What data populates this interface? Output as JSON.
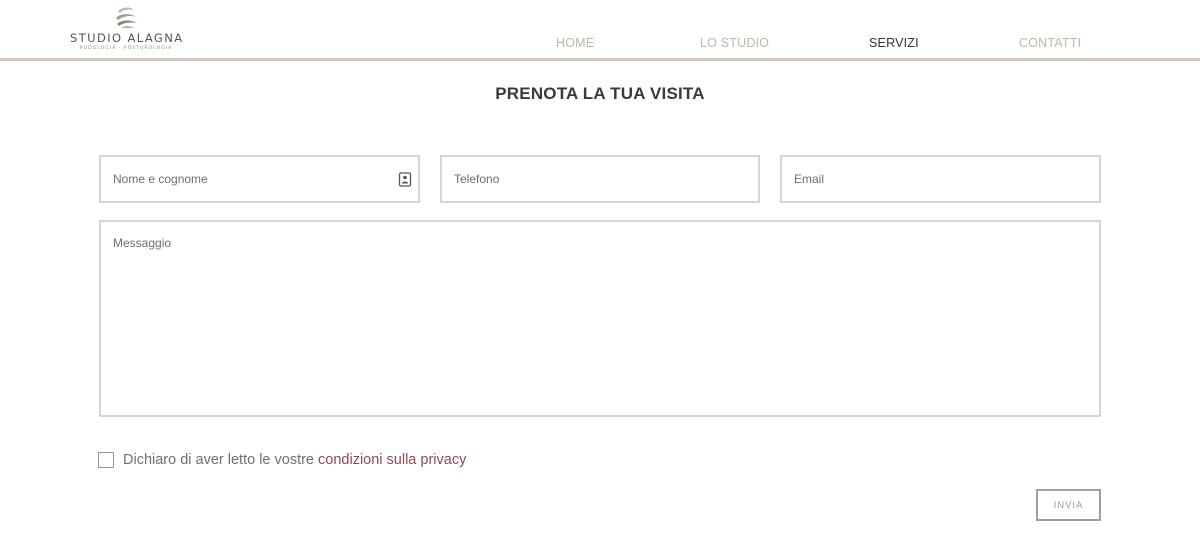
{
  "logo": {
    "name": "STUDIO ALAGNA",
    "tagline": "PODOLOGIA - POSTUROLOGIA",
    "icon": "stone-stack-icon"
  },
  "nav": {
    "items": [
      {
        "label": "HOME",
        "active": false
      },
      {
        "label": "LO STUDIO",
        "active": false
      },
      {
        "label": "SERVIZI",
        "active": true
      },
      {
        "label": "CONTATTI",
        "active": false
      }
    ]
  },
  "form": {
    "title": "PRENOTA LA TUA VISITA",
    "fields": {
      "name": {
        "placeholder": "Nome e cognome",
        "value": ""
      },
      "phone": {
        "placeholder": "Telefono",
        "value": ""
      },
      "email": {
        "placeholder": "Email",
        "value": ""
      },
      "message": {
        "placeholder": "Messaggio",
        "value": ""
      }
    },
    "privacy": {
      "text": "Dichiaro di aver letto le vostre ",
      "link": "condizioni sulla privacy",
      "checked": false
    },
    "submit_label": "INVIA"
  },
  "colors": {
    "accent_link": "#8e4a56",
    "nav_inactive": "#c2b6a5",
    "header_rule": "#cfc8bb"
  }
}
